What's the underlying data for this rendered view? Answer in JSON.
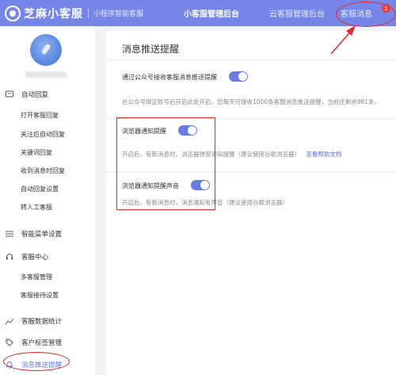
{
  "header": {
    "logo_text": "芝麻小客服",
    "logo_sub": "小程序智能客服",
    "nav": [
      "小客服管理后台",
      "云客服管理后台",
      "客服消息"
    ],
    "badge": "1"
  },
  "sidebar": {
    "groups": [
      {
        "icon": "message-icon",
        "label": "自动回复"
      },
      {
        "icon": "menu-icon",
        "label": "智能菜单设置"
      },
      {
        "icon": "headset-icon",
        "label": "客服中心"
      },
      {
        "icon": "chart-icon",
        "label": "客服数据统计"
      },
      {
        "icon": "tag-icon",
        "label": "客户标签管理"
      },
      {
        "icon": "bell-icon",
        "label": "消息推送提醒"
      }
    ],
    "items": [
      "打开客服回复",
      "关注后自动回复",
      "关键词回复",
      "收到消息时回复",
      "自动回复设置",
      "转人工客服",
      "多客服管理",
      "客服接待设置"
    ]
  },
  "main": {
    "title": "消息推送提醒",
    "wechat_label": "通过公众号接收客服消息推送提醒",
    "wechat_desc": "在公众号绑定账号后开启此处开启，您每天可接收1000条客服消息推送提醒，当前还剩余981条，",
    "browser_label": "浏览器通知提醒",
    "browser_desc": "开启后，有新消息时，浏览器弹窗通知提醒（建议使用谷歌浏览器）",
    "help_link": "查看帮助文档",
    "sound_label": "浏览器通知提醒声音",
    "sound_desc": "开启后，有新消息时，消息通知有声音（建议使用谷歌浏览器）"
  },
  "colors": {
    "accent": "#6a7be0",
    "header_bg": "#7586e8",
    "annotation": "#e0282e"
  }
}
